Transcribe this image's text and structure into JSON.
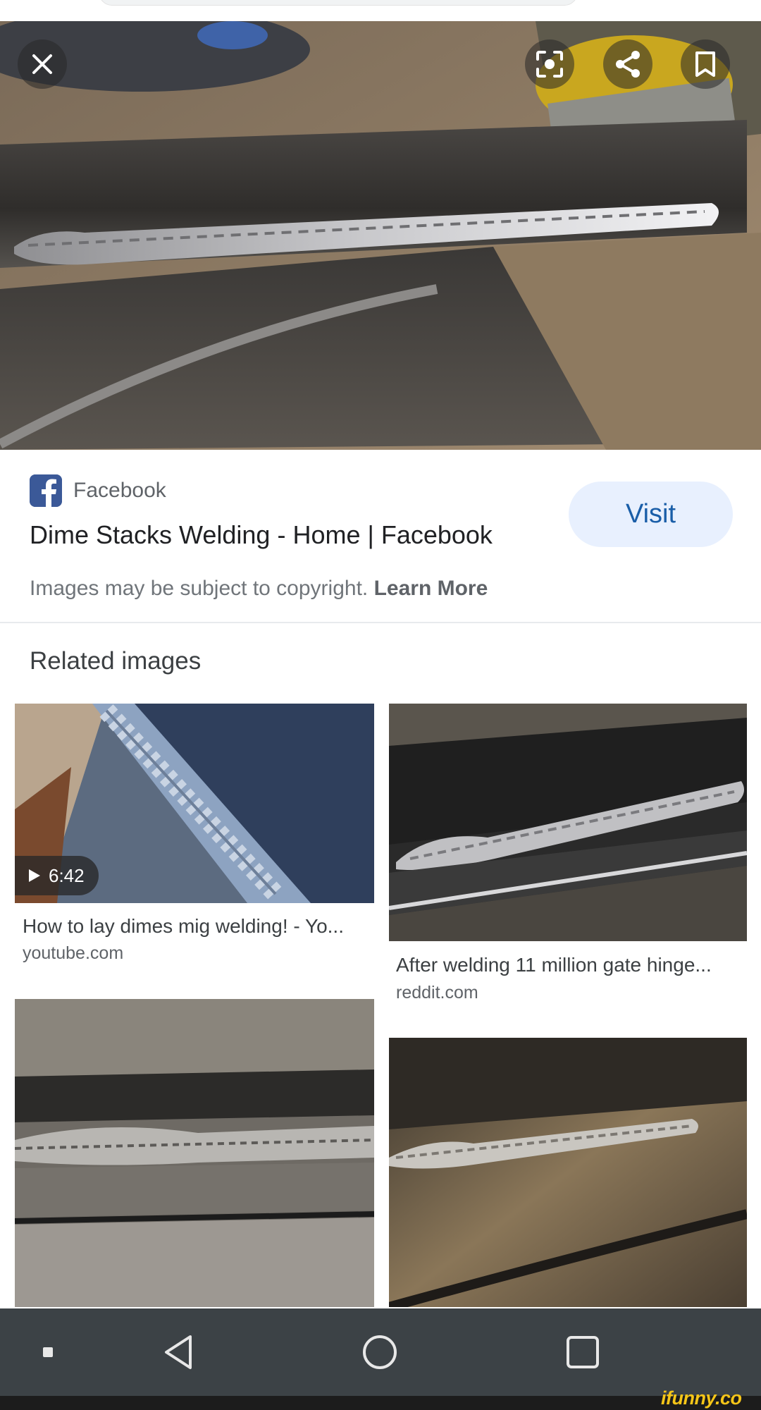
{
  "hero": {
    "close_icon": "close-icon",
    "lens_icon": "google-lens-icon",
    "share_icon": "share-icon",
    "save_icon": "bookmark-icon"
  },
  "source": {
    "logo_icon": "facebook-logo-icon",
    "name": "Facebook",
    "title": "Dime Stacks Welding - Home | Facebook",
    "visit_label": "Visit"
  },
  "copyright": {
    "text": "Images may be subject to copyright.",
    "learn_more": "Learn More"
  },
  "related": {
    "heading": "Related images",
    "items": [
      {
        "title": "How to lay dimes mig welding! - Yo...",
        "domain": "youtube.com",
        "duration": "6:42"
      },
      {
        "title": "After welding 11 million gate hinge...",
        "domain": "reddit.com"
      },
      {
        "title": "",
        "domain": ""
      },
      {
        "title": "",
        "domain": ""
      }
    ]
  },
  "navbar": {
    "items": [
      "dot-icon",
      "back-icon",
      "home-icon",
      "recent-apps-icon"
    ]
  },
  "watermark": {
    "text": "ifunny.co"
  },
  "colors": {
    "visit_bg": "#e8f0fe",
    "visit_text": "#1a5ea8",
    "facebook_blue": "#3b5998",
    "navbar_bg": "#3c4246",
    "watermark": "#f5c518"
  }
}
